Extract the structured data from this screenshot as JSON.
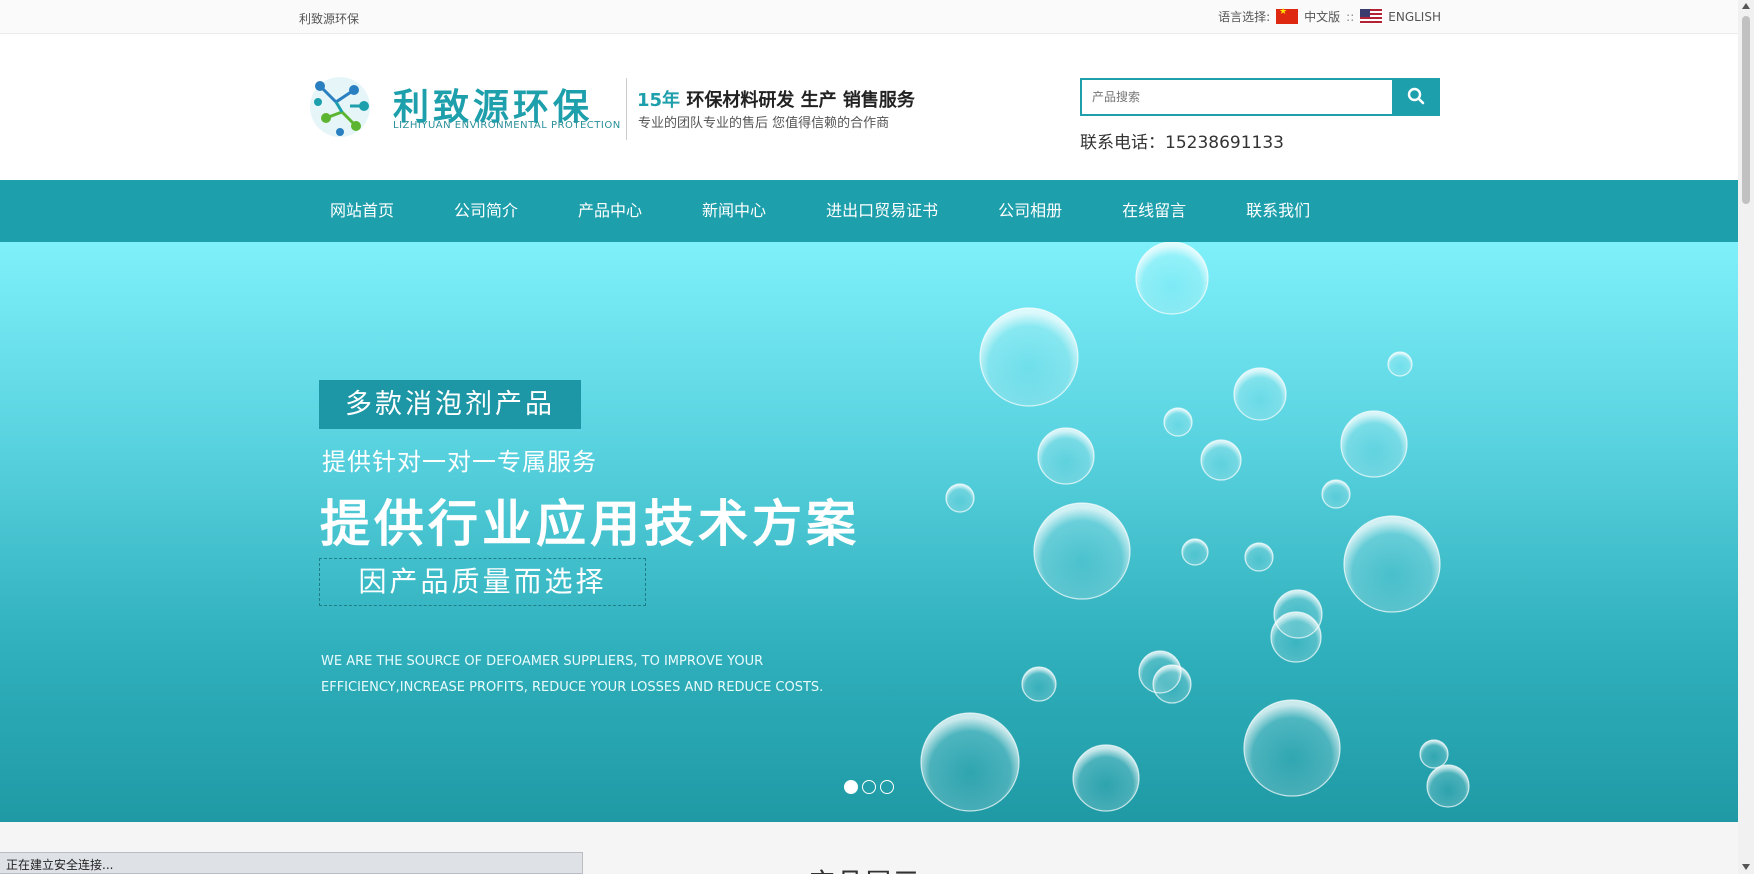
{
  "topbar": {
    "site_name": "利致源环保",
    "lang_label": "语言选择:",
    "lang_cn": "中文版",
    "lang_sep": "::",
    "lang_en": "ENGLISH"
  },
  "header": {
    "logo_cn": "利致源环保",
    "logo_en": "LIZHIYUAN ENVIRONMENTAL PROTECTION",
    "slogan_highlight": "15年",
    "slogan_rest": " 环保材料研发 生产 销售服务",
    "slogan_sub": "专业的团队专业的售后 您值得信赖的合作商",
    "search_placeholder": "产品搜索",
    "phone": "联系电话：15238691133"
  },
  "nav": {
    "items": [
      {
        "label": "网站首页"
      },
      {
        "label": "公司简介"
      },
      {
        "label": "产品中心"
      },
      {
        "label": "新闻中心"
      },
      {
        "label": "进出口贸易证书"
      },
      {
        "label": "公司相册"
      },
      {
        "label": "在线留言"
      },
      {
        "label": "联系我们"
      }
    ]
  },
  "banner": {
    "tag": "多款消泡剂产品",
    "line1": "提供针对一对一专属服务",
    "headline": "提供行业应用技术方案",
    "box_text": "因产品质量而选择",
    "en_line1": "WE ARE THE SOURCE OF DEFOAMER SUPPLIERS, TO IMPROVE YOUR",
    "en_line2": "EFFICIENCY,INCREASE PROFITS, REDUCE YOUR LOSSES AND REDUCE COSTS.",
    "slide_count": 3,
    "active_slide": 1
  },
  "section": {
    "title": "产品展示"
  },
  "statusbar": {
    "text": "正在建立安全连接..."
  },
  "colors": {
    "brand": "#1d9fac",
    "nav_bg": "#1d9fac"
  }
}
